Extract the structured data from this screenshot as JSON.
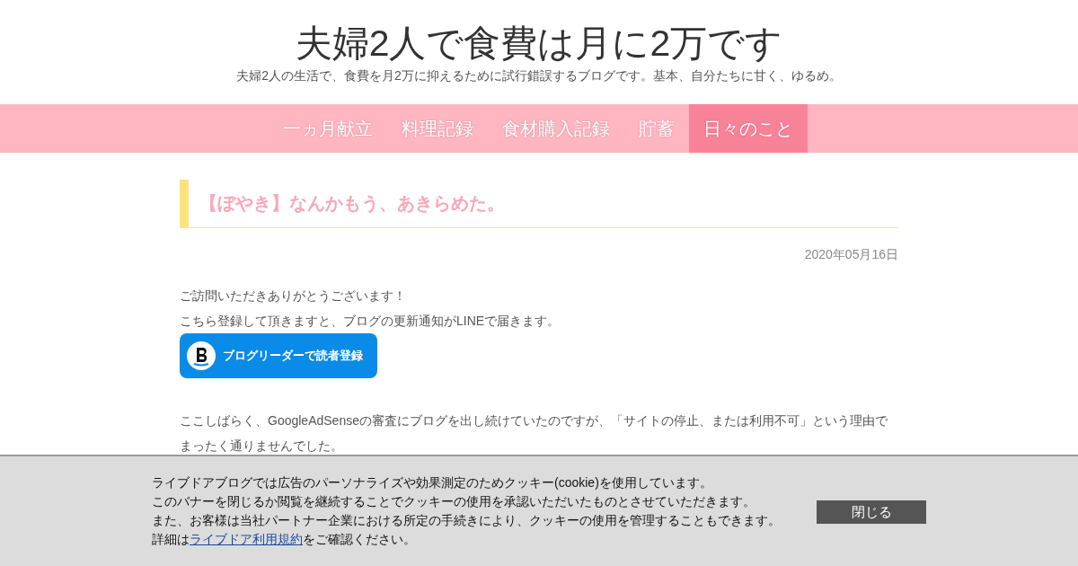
{
  "blog": {
    "title": "夫婦2人で食費は月に2万です",
    "tagline": "夫婦2人の生活で、食費を月2万に抑えるために試行錯誤するブログです。基本、自分たちに甘く、ゆるめ。"
  },
  "nav": [
    {
      "label": "一ヵ月献立",
      "selected": false
    },
    {
      "label": "料理記録",
      "selected": false
    },
    {
      "label": "食材購入記録",
      "selected": false
    },
    {
      "label": "貯蓄",
      "selected": false
    },
    {
      "label": "日々のこと",
      "selected": true
    }
  ],
  "article": {
    "title": "【ぼやき】なんかもう、あきらめた。",
    "date": "2020年05月16日",
    "intro": [
      "ご訪問いただきありがとうございます！",
      "こちら登録して頂きますと、ブログの更新通知がLINEで届きます。"
    ],
    "subscribe_button": "ブログリーダーで読者登録",
    "body": "ここしばらく、GoogleAdSenseの審査にブログを出し続けていたのですが、「サイトの停止、または利用不可」という理由でまったく通りませんでした。"
  },
  "cookie_banner": {
    "lines": [
      "ライブドアブログでは広告のパーソナライズや効果測定のためクッキー(cookie)を使用しています。",
      "このバナーを閉じるか閲覧を継続することでクッキーの使用を承認いただいたものとさせていただきます。",
      "また、お客様は当社パートナー企業における所定の手続きにより、クッキーの使用を管理することもできます。"
    ],
    "last_line": {
      "prefix": "詳細は",
      "link": "ライブドア利用規約",
      "suffix": "をご確認ください。"
    },
    "close_button": "閉じる"
  }
}
